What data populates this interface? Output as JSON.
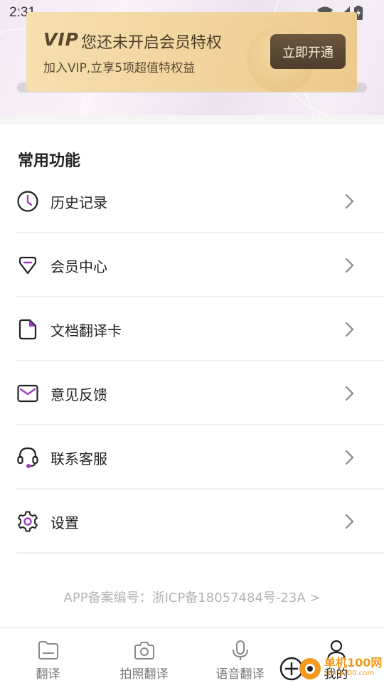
{
  "status_bar": {
    "time": "2:31"
  },
  "vip_banner": {
    "logo_text": "VIP",
    "title": "您还未开启会员特权",
    "subtitle": "加入VIP,立享5项超值特权益",
    "button_label": "立即开通"
  },
  "section": {
    "title": "常用功能"
  },
  "menu": {
    "items": [
      {
        "label": "历史记录",
        "icon": "clock-icon"
      },
      {
        "label": "会员中心",
        "icon": "diamond-icon"
      },
      {
        "label": "文档翻译卡",
        "icon": "document-icon"
      },
      {
        "label": "意见反馈",
        "icon": "envelope-icon"
      },
      {
        "label": "联系客服",
        "icon": "headset-icon"
      },
      {
        "label": "设置",
        "icon": "gear-icon"
      }
    ]
  },
  "footer": {
    "icp_text": "APP备案编号：浙ICP备18057484号-23A >"
  },
  "bottom_nav": {
    "items": [
      {
        "label": "翻译",
        "icon": "folder-icon"
      },
      {
        "label": "拍照翻译",
        "icon": "camera-icon"
      },
      {
        "label": "语音翻译",
        "icon": "microphone-icon"
      },
      {
        "label": "我的",
        "icon": "user-icon",
        "active": true
      }
    ]
  },
  "watermark": {
    "text": "单机100网",
    "sub": "danji100.com"
  },
  "colors": {
    "accent_purple": "#9b3fc4",
    "vip_gold": "#f1d49d",
    "vip_button": "#4e3d2b"
  }
}
